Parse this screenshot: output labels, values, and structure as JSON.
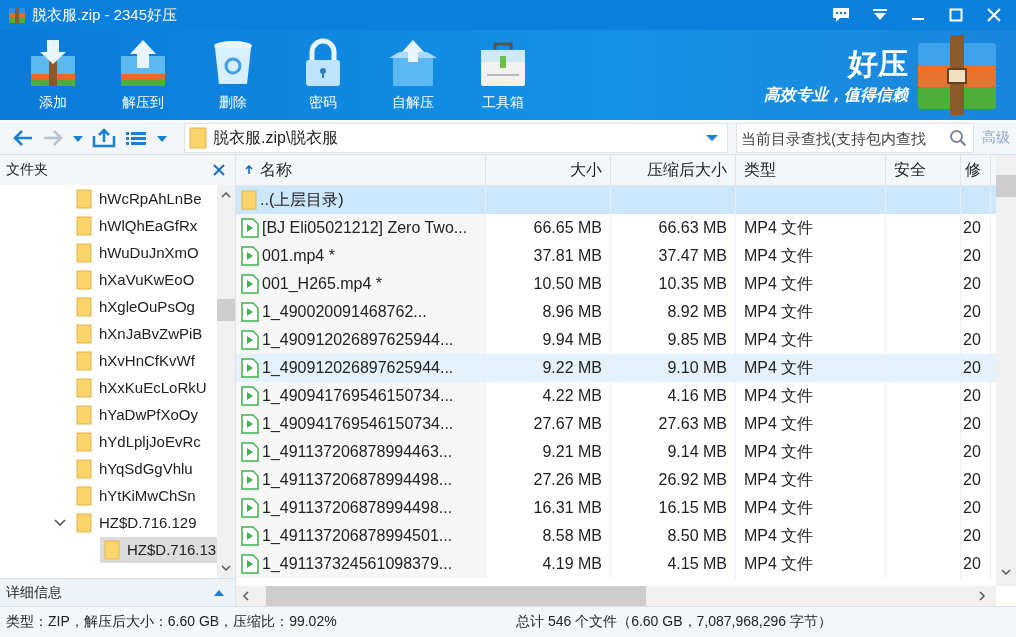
{
  "window": {
    "title": "脱衣服.zip - 2345好压"
  },
  "toolbar": [
    {
      "label": "添加",
      "kind": "add"
    },
    {
      "label": "解压到",
      "kind": "extract"
    },
    {
      "label": "删除",
      "kind": "delete"
    },
    {
      "label": "密码",
      "kind": "password"
    },
    {
      "label": "自解压",
      "kind": "sfx"
    },
    {
      "label": "工具箱",
      "kind": "tools"
    }
  ],
  "brand": {
    "name": "好压",
    "slogan": "高效专业，值得信赖"
  },
  "nav": {
    "path": "脱衣服.zip\\脱衣服",
    "search_placeholder": "当前目录查找(支持包内查找",
    "advanced": "高级"
  },
  "tree": {
    "title": "文件夹",
    "items": [
      {
        "name": "hWcRpAhLnBe",
        "expanded": false,
        "selected": false
      },
      {
        "name": "hWlQhEaGfRx",
        "expanded": false,
        "selected": false
      },
      {
        "name": "hWuDuJnXmO",
        "expanded": false,
        "selected": false
      },
      {
        "name": "hXaVuKwEoO",
        "expanded": false,
        "selected": false
      },
      {
        "name": "hXgleOuPsOg",
        "expanded": false,
        "selected": false
      },
      {
        "name": "hXnJaBvZwPiB",
        "expanded": false,
        "selected": false
      },
      {
        "name": "hXvHnCfKvWf",
        "expanded": false,
        "selected": false
      },
      {
        "name": "hXxKuEcLoRkU",
        "expanded": false,
        "selected": false
      },
      {
        "name": "hYaDwPfXoOy",
        "expanded": false,
        "selected": false
      },
      {
        "name": "hYdLpljJoEvRc",
        "expanded": false,
        "selected": false
      },
      {
        "name": "hYqSdGgVhlu",
        "expanded": false,
        "selected": false
      },
      {
        "name": "hYtKiMwChSn",
        "expanded": false,
        "selected": false
      },
      {
        "name": "HZ$D.716.129",
        "expanded": true,
        "selected": false,
        "children": [
          {
            "name": "HZ$D.716.13",
            "expanded": false,
            "selected": true
          }
        ]
      }
    ]
  },
  "details_label": "详细信息",
  "columns": [
    "名称",
    "大小",
    "压缩后大小",
    "类型",
    "安全",
    "修"
  ],
  "files": [
    {
      "kind": "folder",
      "name": "..(上层目录)",
      "selected": true,
      "hover": false
    },
    {
      "kind": "video",
      "name": "[BJ Eli05021212] Zero Two...",
      "size": "66.65 MB",
      "packed": "66.63 MB",
      "type": "MP4 文件",
      "modified": "20",
      "selected": false,
      "hover": false
    },
    {
      "kind": "video",
      "name": "001.mp4 *",
      "size": "37.81 MB",
      "packed": "37.47 MB",
      "type": "MP4 文件",
      "modified": "20",
      "selected": false,
      "hover": false
    },
    {
      "kind": "video",
      "name": "001_H265.mp4 *",
      "size": "10.50 MB",
      "packed": "10.35 MB",
      "type": "MP4 文件",
      "modified": "20",
      "selected": false,
      "hover": false
    },
    {
      "kind": "video",
      "name": "1_490020091468762...",
      "size": "8.96 MB",
      "packed": "8.92 MB",
      "type": "MP4 文件",
      "modified": "20",
      "selected": false,
      "hover": false
    },
    {
      "kind": "video",
      "name": "1_490912026897625944...",
      "size": "9.94 MB",
      "packed": "9.85 MB",
      "type": "MP4 文件",
      "modified": "20",
      "selected": false,
      "hover": false
    },
    {
      "kind": "video",
      "name": "1_490912026897625944...",
      "size": "9.22 MB",
      "packed": "9.10 MB",
      "type": "MP4 文件",
      "modified": "20",
      "selected": false,
      "hover": true
    },
    {
      "kind": "video",
      "name": "1_490941769546150734...",
      "size": "4.22 MB",
      "packed": "4.16 MB",
      "type": "MP4 文件",
      "modified": "20",
      "selected": false,
      "hover": false
    },
    {
      "kind": "video",
      "name": "1_490941769546150734...",
      "size": "27.67 MB",
      "packed": "27.63 MB",
      "type": "MP4 文件",
      "modified": "20",
      "selected": false,
      "hover": false
    },
    {
      "kind": "video",
      "name": "1_491137206878994463...",
      "size": "9.21 MB",
      "packed": "9.14 MB",
      "type": "MP4 文件",
      "modified": "20",
      "selected": false,
      "hover": false
    },
    {
      "kind": "video",
      "name": "1_491137206878994498...",
      "size": "27.26 MB",
      "packed": "26.92 MB",
      "type": "MP4 文件",
      "modified": "20",
      "selected": false,
      "hover": false
    },
    {
      "kind": "video",
      "name": "1_491137206878994498...",
      "size": "16.31 MB",
      "packed": "16.15 MB",
      "type": "MP4 文件",
      "modified": "20",
      "selected": false,
      "hover": false
    },
    {
      "kind": "video",
      "name": "1_491137206878994501...",
      "size": "8.58 MB",
      "packed": "8.50 MB",
      "type": "MP4 文件",
      "modified": "20",
      "selected": false,
      "hover": false
    },
    {
      "kind": "video",
      "name": "1_491137324561098379...",
      "size": "4.19 MB",
      "packed": "4.15 MB",
      "type": "MP4 文件",
      "modified": "20",
      "selected": false,
      "hover": false
    }
  ],
  "status_bar": {
    "left": "类型：ZIP，解压后大小：6.60 GB，压缩比：99.02%",
    "right": "总计 546 个文件（6.60 GB，7,087,968,296 字节）"
  }
}
